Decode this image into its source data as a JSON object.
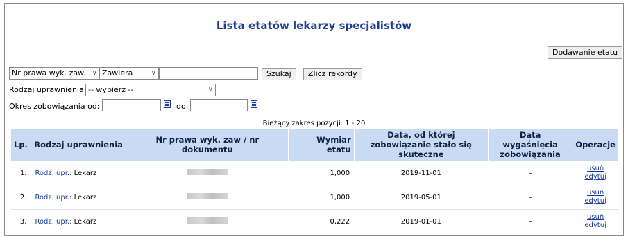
{
  "page": {
    "title": "Lista etatów lekarzy specjalistów",
    "add_button": "Dodawanie etatu"
  },
  "filters": {
    "field_select": "Nr prawa wyk. zaw.",
    "operator_select": "Zawiera",
    "search_value": "",
    "search_button": "Szukaj",
    "count_button": "Zlicz rekordy",
    "rodzaj_label": "Rodzaj uprawnienia:",
    "rodzaj_select": "-- wybierz --",
    "okres_label": "Okres zobowiązania od:",
    "do_label": "do:",
    "date_from": "",
    "date_to": ""
  },
  "range_text": "Bieżący zakres pozycji: 1 - 20",
  "table": {
    "headers": {
      "lp": "Lp.",
      "rodzaj": "Rodzaj uprawnienia",
      "nr": "Nr prawa wyk. zaw / nr dokumentu",
      "wymiar": "Wymiar etatu",
      "data_od": "Data, od której zobowiązanie stało się skuteczne",
      "data_wyg": "Data wygaśnięcia zobowiązania",
      "operacje": "Operacje"
    },
    "rows": [
      {
        "lp": "1.",
        "rodz_link": "Rodz. upr.",
        "rodz_value": ": Lekarz",
        "wymiar": "1,000",
        "data_od": "2019-11-01",
        "data_wyg": "–",
        "op_delete": "usuń",
        "op_edit": "edytuj"
      },
      {
        "lp": "2.",
        "rodz_link": "Rodz. upr.",
        "rodz_value": ": Lekarz",
        "wymiar": "1,000",
        "data_od": "2019-05-01",
        "data_wyg": "–",
        "op_delete": "usuń",
        "op_edit": "edytuj"
      },
      {
        "lp": "3.",
        "rodz_link": "Rodz. upr.",
        "rodz_value": ": Lekarz",
        "wymiar": "0,222",
        "data_od": "2019-01-01",
        "data_wyg": "–",
        "op_delete": "usuń",
        "op_edit": "edytuj"
      }
    ]
  }
}
